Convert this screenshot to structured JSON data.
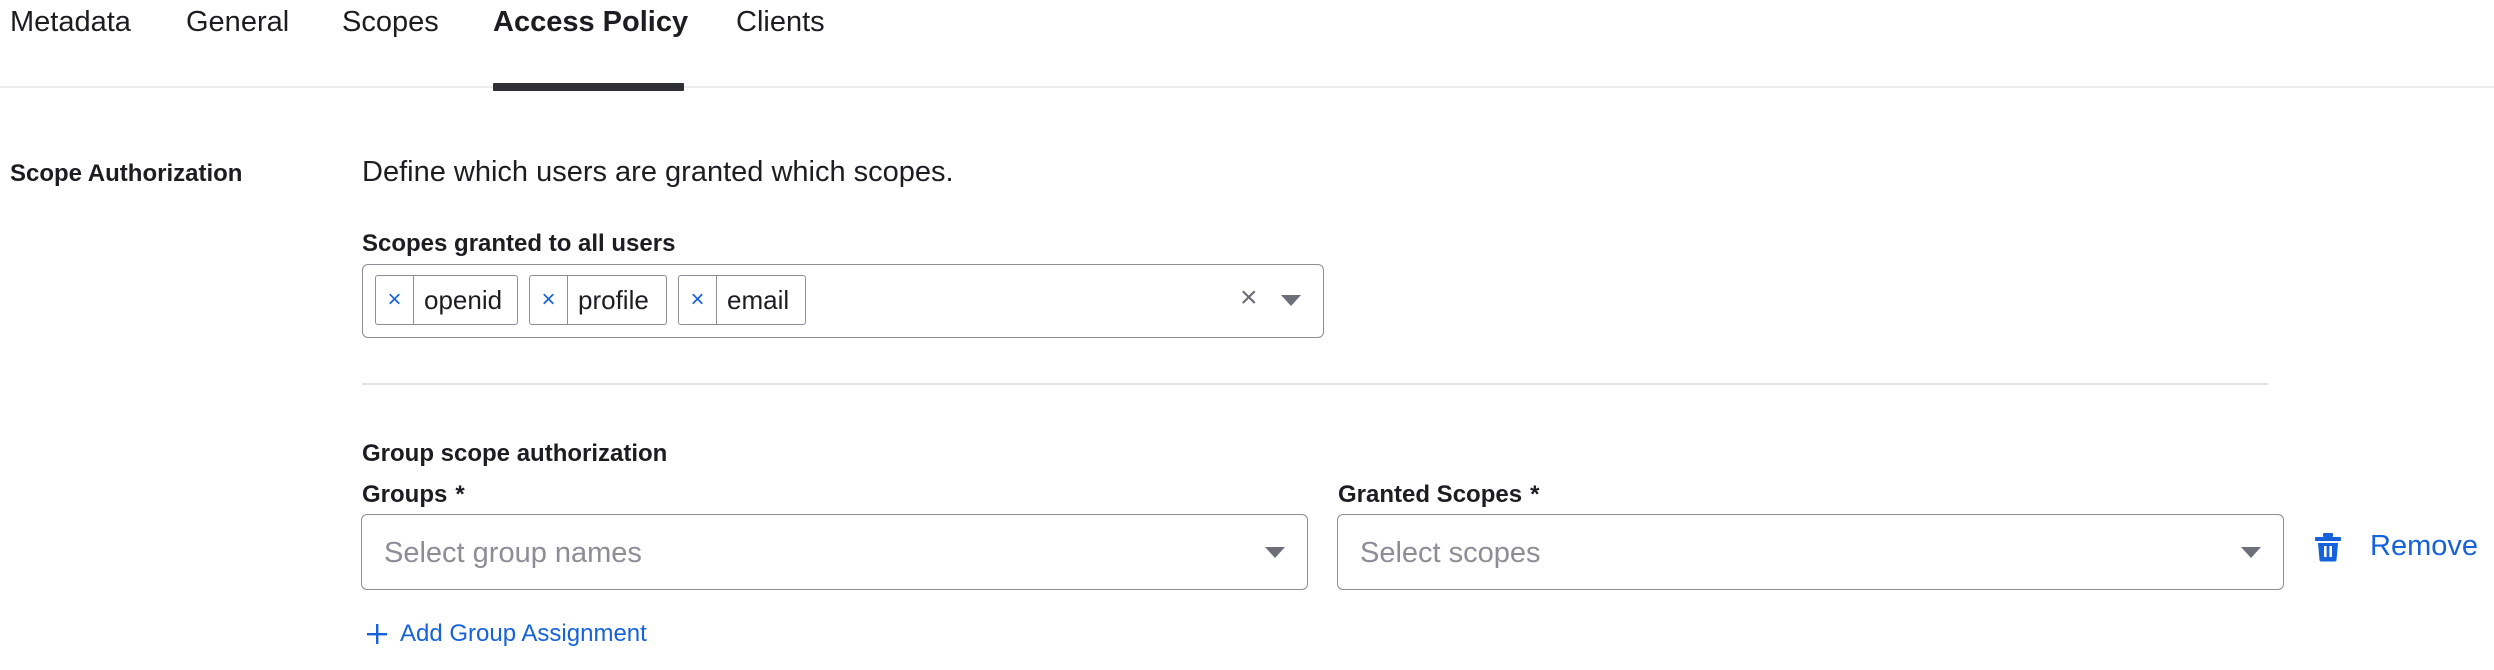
{
  "tabs": [
    {
      "label": "Metadata",
      "active": false
    },
    {
      "label": "General",
      "active": false
    },
    {
      "label": "Scopes",
      "active": false
    },
    {
      "label": "Access Policy",
      "active": true
    },
    {
      "label": "Clients",
      "active": false
    }
  ],
  "scope_authorization": {
    "section_label": "Scope Authorization",
    "description": "Define which users are granted which scopes.",
    "all_users_label": "Scopes granted to all users",
    "all_users_scopes": [
      "openid",
      "profile",
      "email"
    ],
    "chip_remove_glyph": "×",
    "clear_glyph": "×"
  },
  "group_authorization": {
    "heading": "Group scope authorization",
    "groups_label": "Groups",
    "groups_placeholder": "Select group names",
    "scopes_label": "Granted Scopes",
    "scopes_placeholder": "Select scopes",
    "required_marker": "*",
    "remove_label": "Remove",
    "add_label": "Add Group Assignment"
  },
  "colors": {
    "accent": "#1662dd",
    "text": "#1d1d21",
    "border": "#8d8d95",
    "placeholder": "#8d8d95",
    "tab_indicator": "#2e3036"
  },
  "icons": {
    "chip_remove": "close-icon",
    "clear": "clear-icon",
    "dropdown": "caret-down-icon",
    "remove": "trash-icon",
    "add": "plus-icon"
  }
}
